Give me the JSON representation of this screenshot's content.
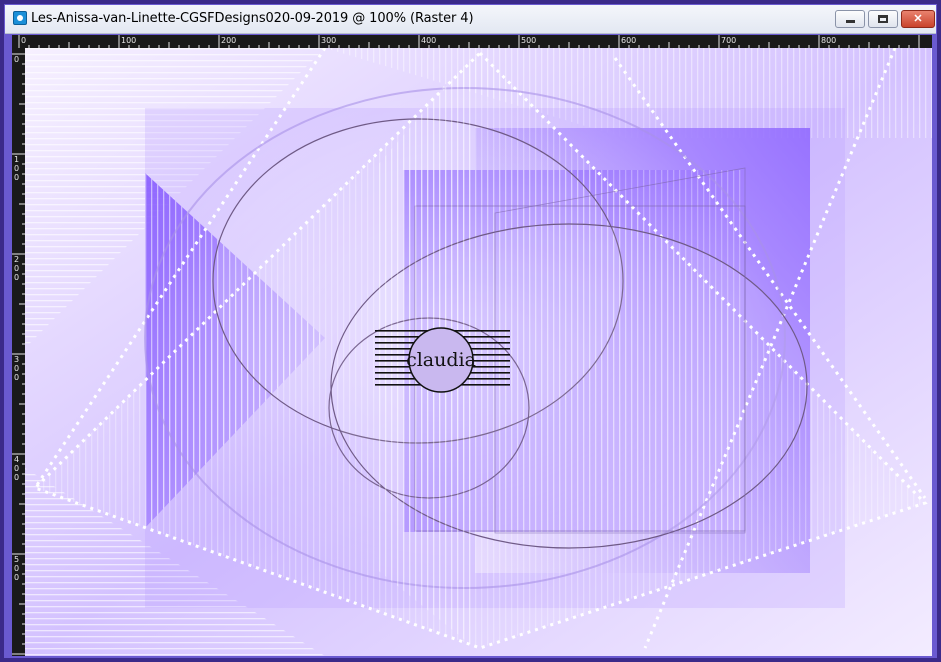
{
  "window": {
    "title": "Les-Anissa-van-Linette-CGSFDesigns020-09-2019 @ 100% (Raster 4)",
    "icon": "image-document-icon",
    "buttons": {
      "minimize": "minimize-icon",
      "maximize": "maximize-icon",
      "close": "close-icon",
      "close_glyph": "✕"
    }
  },
  "rulers": {
    "horizontal_labels": [
      "0",
      "100",
      "200",
      "300",
      "400",
      "500",
      "600",
      "700",
      "800"
    ],
    "vertical_labels": [
      "0",
      "100",
      "200",
      "300",
      "400",
      "500"
    ]
  },
  "canvas": {
    "watermark": "claudia",
    "palette": {
      "violet": "#8b5cf6",
      "deep": "#7c4dff",
      "light": "#d9c8ff",
      "white": "#ffffff"
    }
  }
}
